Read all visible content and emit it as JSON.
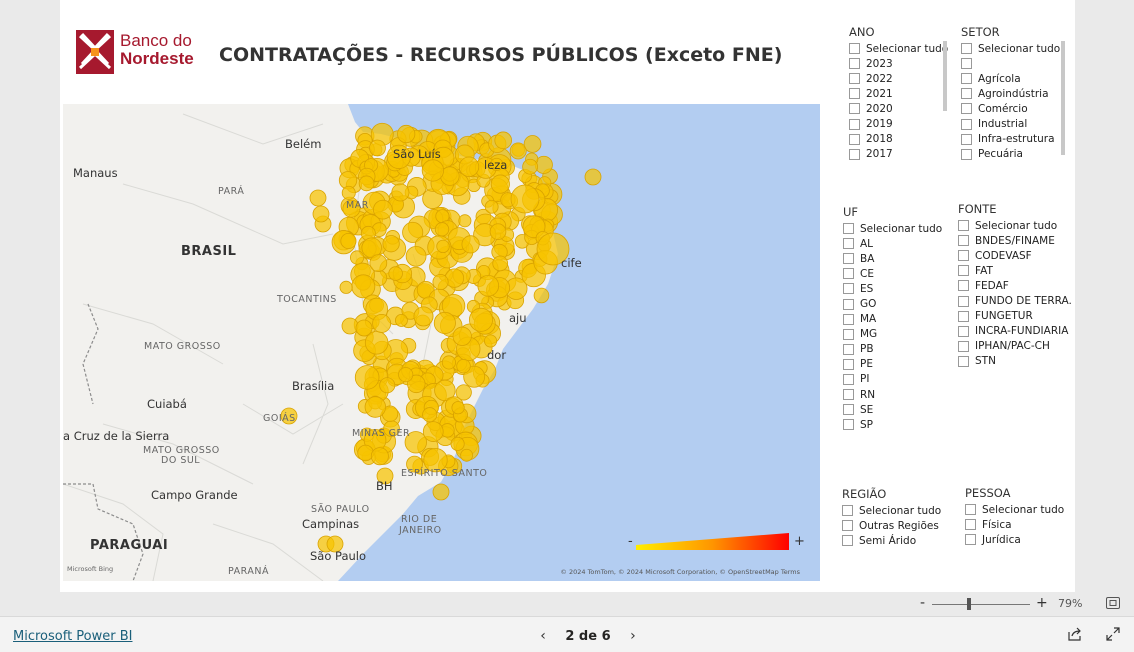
{
  "logo": {
    "line1": "Banco do",
    "line2": "Nordeste"
  },
  "report": {
    "title": "CONTRATAÇÕES - RECURSOS  PÚBLICOS (Exceto FNE)"
  },
  "map": {
    "labels": {
      "belem": "Belém",
      "manaus": "Manaus",
      "para": "PARÁ",
      "brasil": "BRASIL",
      "tocantins": "TOCANTINS",
      "mato_grosso": "MATO GROSSO",
      "brasilia": "Brasília",
      "cuiaba": "Cuiabá",
      "goias": "GOIÁS",
      "cruz": "a Cruz de la Sierra",
      "mgs": "MATO GROSSO",
      "mgs2": "DO SUL",
      "campo_grande": "Campo Grande",
      "minas": "MINAS GER",
      "bh": "BH",
      "espirito": "ESPÍRITO SANTO",
      "sp_state": "SÃO PAULO",
      "campinas": "Campinas",
      "rio": "RIO DE",
      "rio2": "JANEIRO",
      "paraguai": "PARAGUAI",
      "sao_paulo": "São Paulo",
      "parana": "PARANÁ",
      "sao_luis": "São Luís",
      "fortaleza": "leza",
      "recife": "cife",
      "aracaju": "aju",
      "salvador": "dor",
      "mar": "MAR"
    },
    "credit": "© 2024 TomTom, © 2024 Microsoft Corporation, © OpenStreetMap  Terms",
    "bing": "Microsoft Bing",
    "legend_minus": "-",
    "legend_plus": "+",
    "colors": {
      "ocean": "#b3cdf1",
      "land": "#f2f1ee",
      "bubble": "#f7c300",
      "bubble_stroke": "#d9a300",
      "hot": "#f26522"
    }
  },
  "slicers": {
    "ano": {
      "title": "ANO",
      "items": [
        "Selecionar tudo",
        "2023",
        "2022",
        "2021",
        "2020",
        "2019",
        "2018",
        "2017"
      ]
    },
    "setor": {
      "title": "SETOR",
      "items": [
        "Selecionar tudo",
        "",
        "Agrícola",
        "Agroindústria",
        "Comércio",
        "Industrial",
        "Infra-estrutura",
        "Pecuária"
      ]
    },
    "uf": {
      "title": "UF",
      "items": [
        "Selecionar tudo",
        "AL",
        "BA",
        "CE",
        "ES",
        "GO",
        "MA",
        "MG",
        "PB",
        "PE",
        "PI",
        "RN",
        "SE",
        "SP"
      ]
    },
    "fonte": {
      "title": "FONTE",
      "items": [
        "Selecionar tudo",
        "BNDES/FINAME",
        "CODEVASF",
        "FAT",
        "FEDAF",
        "FUNDO DE TERRA...",
        "FUNGETUR",
        "INCRA-FUNDIARIA",
        "IPHAN/PAC-CH",
        "STN"
      ]
    },
    "regiao": {
      "title": "REGIÃO",
      "items": [
        "Selecionar tudo",
        "Outras Regiões",
        "Semi Árido"
      ]
    },
    "pessoa": {
      "title": "PESSOA",
      "items": [
        "Selecionar tudo",
        "Física",
        "Jurídica"
      ]
    }
  },
  "zoom": {
    "minus": "-",
    "plus": "+",
    "percent": "79%"
  },
  "footer": {
    "link": "Microsoft Power BI",
    "page": "2 de 6",
    "prev": "‹",
    "next": "›"
  },
  "icons": [
    "logo-mark-icon",
    "fit-to-page-icon",
    "share-icon",
    "expand-icon",
    "chevron-left-icon",
    "chevron-right-icon"
  ]
}
